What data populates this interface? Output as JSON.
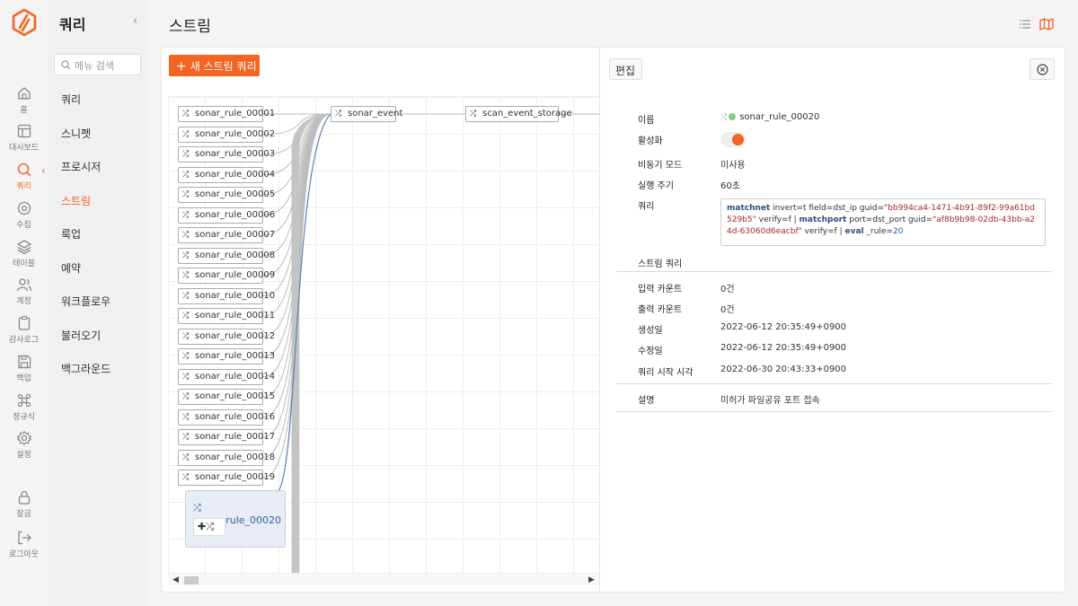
{
  "colors": {
    "accent": "#f26522",
    "link": "#3a5f9a",
    "active_dot": "#7ed07b"
  },
  "rail": {
    "items": [
      {
        "label": "홈",
        "icon": "home-icon"
      },
      {
        "label": "대시보드",
        "icon": "dashboard-icon"
      },
      {
        "label": "쿼리",
        "icon": "search-icon",
        "active": true
      },
      {
        "label": "수집",
        "icon": "collect-icon"
      },
      {
        "label": "테이블",
        "icon": "table-layers-icon"
      },
      {
        "label": "계정",
        "icon": "users-icon"
      },
      {
        "label": "감사로그",
        "icon": "clipboard-icon"
      },
      {
        "label": "백업",
        "icon": "save-icon"
      },
      {
        "label": "정규식",
        "icon": "command-icon"
      },
      {
        "label": "설정",
        "icon": "gear-icon"
      },
      {
        "label": "잠금",
        "icon": "lock-icon"
      },
      {
        "label": "로그아웃",
        "icon": "logout-icon"
      }
    ]
  },
  "menu": {
    "title": "쿼리",
    "collapse": "‹",
    "search_placeholder": "메뉴 검색",
    "items": [
      "쿼리",
      "스니펫",
      "프로시저",
      "스트림",
      "룩업",
      "예약",
      "워크플로우",
      "불러오기",
      "백그라운드"
    ],
    "active": "스트림"
  },
  "main": {
    "title": "스트림",
    "new_button": "새 스트림 쿼리",
    "new_button_icon": "+"
  },
  "graph": {
    "rules": [
      "sonar_rule_00001",
      "sonar_rule_00002",
      "sonar_rule_00003",
      "sonar_rule_00004",
      "sonar_rule_00005",
      "sonar_rule_00006",
      "sonar_rule_00007",
      "sonar_rule_00008",
      "sonar_rule_00009",
      "sonar_rule_00010",
      "sonar_rule_00011",
      "sonar_rule_00012",
      "sonar_rule_00013",
      "sonar_rule_00014",
      "sonar_rule_00015",
      "sonar_rule_00016",
      "sonar_rule_00017",
      "sonar_rule_00018",
      "sonar_rule_00019"
    ],
    "event_node": "sonar_event",
    "storage_node": "scan_event_storage",
    "selected_node": "sonar_rule_00020",
    "add_label": "✚⤮",
    "shuffle_glyph": "⤮"
  },
  "detail": {
    "edit_button": "편집",
    "fields": {
      "name_label": "이름",
      "name_value": "sonar_rule_00020",
      "enabled_label": "활성화",
      "enabled": true,
      "async_label": "비동기 모드",
      "async_value": "미사용",
      "interval_label": "실행 주기",
      "interval_value": "60초",
      "query_label": "쿼리",
      "stream_query_label": "스트림 쿼리",
      "input_count_label": "입력 카운트",
      "input_count_value": "0건",
      "output_count_label": "출력 카운트",
      "output_count_value": "0건",
      "created_label": "생성일",
      "created_value": "2022-06-12 20:35:49+0900",
      "modified_label": "수정일",
      "modified_value": "2022-06-12 20:35:49+0900",
      "query_start_label": "쿼리 시작 시각",
      "query_start_value": "2022-06-30 20:43:33+0900",
      "description_label": "설명",
      "description_value": "미허가 파일공유 포트 접속"
    },
    "query": {
      "cmd1": "matchnet",
      "text1": " invert=t field=dst_ip guid=",
      "guid1": "\"bb994ca4-1471-4b91-89f2-99a61bd529b5\"",
      "text2": " verify=f | ",
      "cmd2": "matchport",
      "text3": " port=dst_port guid=",
      "guid2": "\"af8b9b98-02db-43bb-a24d-63060d6eacbf\"",
      "text4": " verify=f | ",
      "cmd3": "eval",
      "text5": " _rule=",
      "num": "20"
    }
  }
}
